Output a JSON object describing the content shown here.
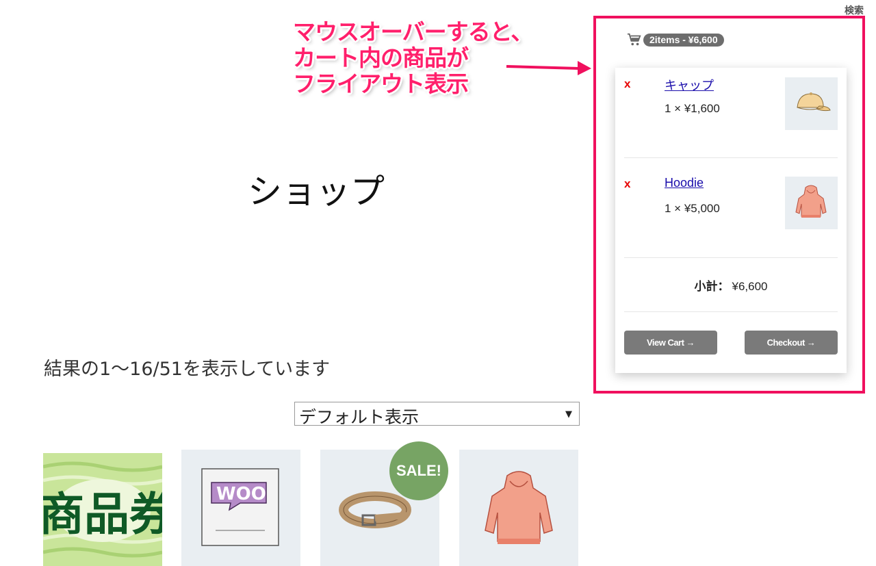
{
  "header": {
    "search_label": "検索"
  },
  "annotation": {
    "lines": [
      "マウスオーバーすると、",
      "カート内の商品が",
      "フライアウト表示"
    ],
    "color": "#ff1f6b"
  },
  "mini_cart": {
    "summary": "2items - ¥6,600",
    "items": [
      {
        "remove": "x",
        "name": "キャップ",
        "qty_price": "1 × ¥1,600",
        "thumb_icon": "cap-icon"
      },
      {
        "remove": "x",
        "name": "Hoodie",
        "qty_price": "1 × ¥5,000",
        "thumb_icon": "hoodie-icon"
      }
    ],
    "subtotal_label": "小計：",
    "subtotal_value": "¥6,600",
    "view_cart_label": "View Cart →",
    "checkout_label": "Checkout →"
  },
  "main": {
    "title": "ショップ",
    "result_count": "結果の1〜16/51を表示しています",
    "orderby_selected": "デフォルト表示",
    "products": [
      {
        "icon": "gift-voucher-icon",
        "label_art": "商品券"
      },
      {
        "icon": "woo-album-icon",
        "label_art": "WOO"
      },
      {
        "icon": "belt-icon",
        "badge": "SALE!"
      },
      {
        "icon": "hoodie-icon"
      }
    ]
  },
  "colors": {
    "accent": "#f0105e",
    "sale": "#77a464",
    "button": "#7a7a7a",
    "remove": "#e60000"
  }
}
